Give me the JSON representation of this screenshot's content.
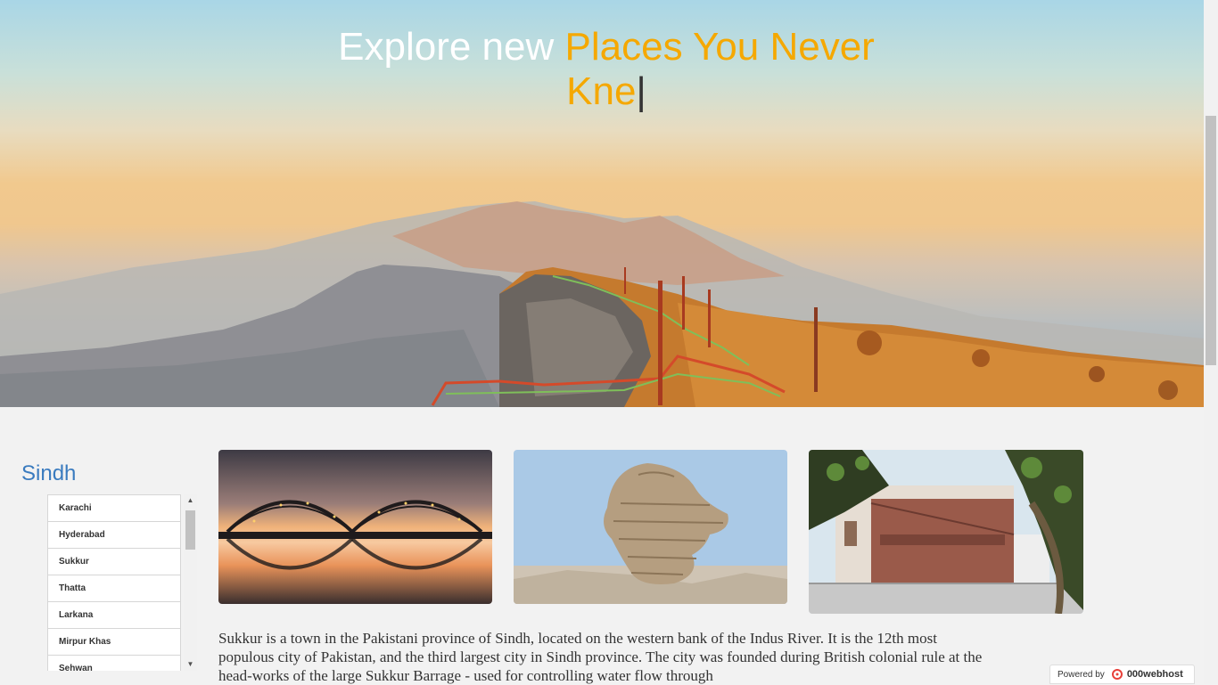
{
  "hero": {
    "title_white": "Explore new ",
    "title_accent": "Places You Never Kne",
    "caret": "|"
  },
  "sidebar": {
    "region": "Sindh",
    "cities": [
      "Karachi",
      "Hyderabad",
      "Sukkur",
      "Thatta",
      "Larkana",
      "Mirpur Khas",
      "Sehwan"
    ]
  },
  "gallery": {
    "images": [
      {
        "icon": "bridge-photo"
      },
      {
        "icon": "rock-formation-photo"
      },
      {
        "icon": "historic-building-photo"
      }
    ]
  },
  "description": "Sukkur is a town in the Pakistani province of Sindh, located on the western bank of the Indus River. It is the 12th most populous city of Pakistan, and the third largest city in Sindh province. The city was founded during British colonial rule at the head-works of the large Sukkur Barrage - used for controlling water flow through",
  "badge": {
    "powered_by": "Powered by",
    "brand": "000webhost"
  },
  "colors": {
    "accent": "#f5a800",
    "region_title": "#3a7bbf",
    "background": "#f2f2f2"
  }
}
